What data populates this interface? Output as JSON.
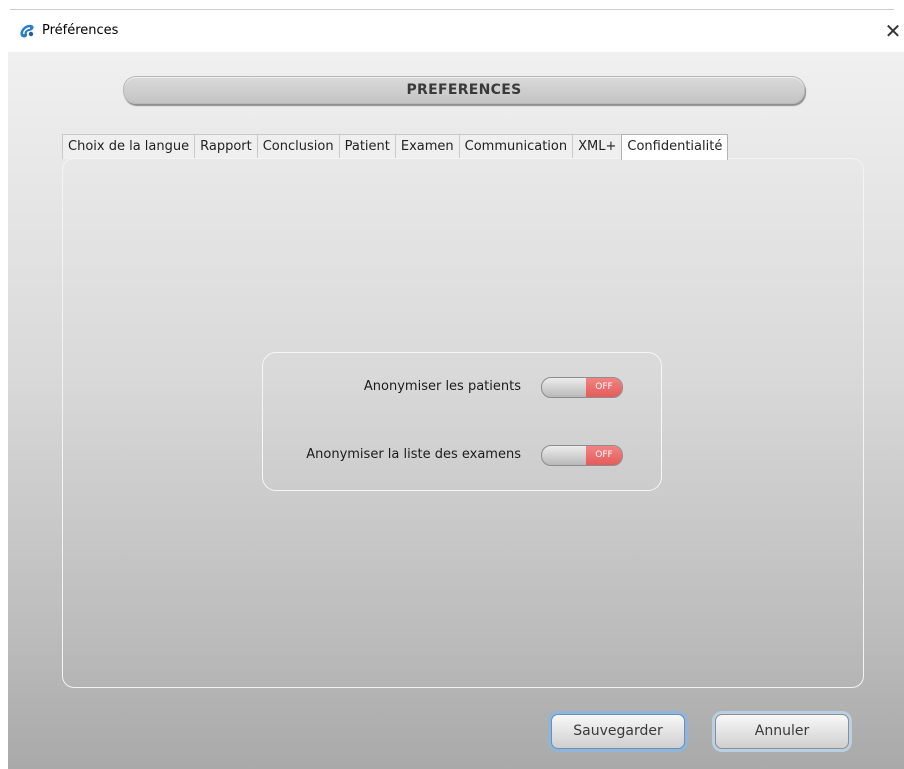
{
  "window": {
    "title": "Préférences",
    "close_glyph": "✕"
  },
  "icons": {
    "app": "app-logo-icon",
    "close": "close-icon"
  },
  "header": {
    "title": "PREFERENCES"
  },
  "tabs": [
    {
      "label": "Choix de la langue",
      "active": false
    },
    {
      "label": "Rapport",
      "active": false
    },
    {
      "label": "Conclusion",
      "active": false
    },
    {
      "label": "Patient",
      "active": false
    },
    {
      "label": "Examen",
      "active": false
    },
    {
      "label": "Communication",
      "active": false
    },
    {
      "label": "XML+",
      "active": false
    },
    {
      "label": "Confidentialité",
      "active": true
    }
  ],
  "privacy": {
    "anonymize_patients": {
      "label": "Anonymiser les patients",
      "state": "OFF"
    },
    "anonymize_exams": {
      "label": "Anonymiser la liste des examens",
      "state": "OFF"
    }
  },
  "buttons": {
    "save": "Sauvegarder",
    "cancel": "Annuler"
  },
  "colors": {
    "toggle_off": "#e55b5b",
    "focus_ring": "#8fb5db"
  }
}
